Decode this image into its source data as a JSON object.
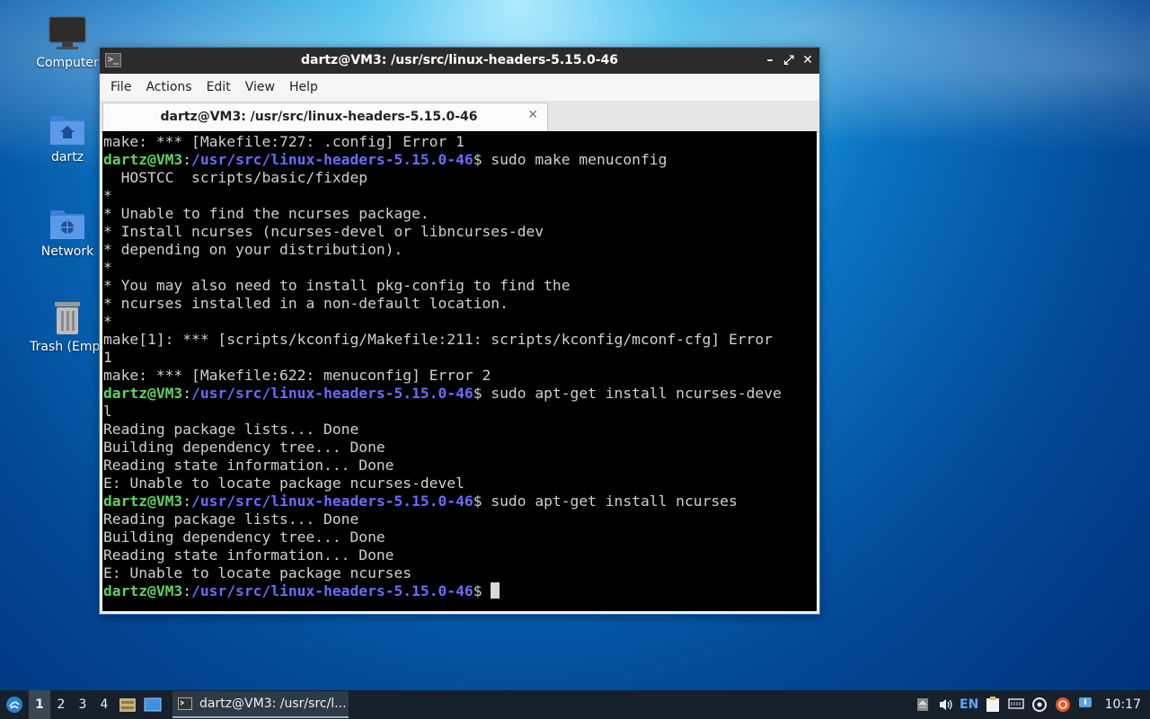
{
  "desktop": {
    "icons": [
      {
        "label": "Computer"
      },
      {
        "label": "dartz"
      },
      {
        "label": "Network"
      },
      {
        "label": "Trash (Empt"
      }
    ]
  },
  "window": {
    "title": "dartz@VM3: /usr/src/linux-headers-5.15.0-46",
    "controls": {
      "minimize": "–",
      "maximize": "⤢",
      "close": "✕"
    },
    "menu": [
      "File",
      "Actions",
      "Edit",
      "View",
      "Help"
    ],
    "tab": {
      "label": "dartz@VM3: /usr/src/linux-headers-5.15.0-46",
      "close": "✕"
    }
  },
  "terminal": {
    "prompt_user": "dartz@VM3",
    "prompt_sep": ":",
    "prompt_path": "/usr/src/linux-headers-5.15.0-46",
    "prompt_suffix": "$ ",
    "lines": [
      {
        "text": "make: *** [Makefile:727: .config] Error 1"
      },
      {
        "prompt": true,
        "cmd": "sudo make menuconfig"
      },
      {
        "text": "  HOSTCC  scripts/basic/fixdep"
      },
      {
        "text": "*"
      },
      {
        "text": "* Unable to find the ncurses package."
      },
      {
        "text": "* Install ncurses (ncurses-devel or libncurses-dev"
      },
      {
        "text": "* depending on your distribution)."
      },
      {
        "text": "*"
      },
      {
        "text": "* You may also need to install pkg-config to find the"
      },
      {
        "text": "* ncurses installed in a non-default location."
      },
      {
        "text": "*"
      },
      {
        "text": "make[1]: *** [scripts/kconfig/Makefile:211: scripts/kconfig/mconf-cfg] Error"
      },
      {
        "text": "1"
      },
      {
        "text": "make: *** [Makefile:622: menuconfig] Error 2"
      },
      {
        "prompt": true,
        "cmd": "sudo apt-get install ncurses-deve"
      },
      {
        "text": "l"
      },
      {
        "text": "Reading package lists... Done"
      },
      {
        "text": "Building dependency tree... Done"
      },
      {
        "text": "Reading state information... Done"
      },
      {
        "text": "E: Unable to locate package ncurses-devel"
      },
      {
        "prompt": true,
        "cmd": "sudo apt-get install ncurses"
      },
      {
        "text": "Reading package lists... Done"
      },
      {
        "text": "Building dependency tree... Done"
      },
      {
        "text": "Reading state information... Done"
      },
      {
        "text": "E: Unable to locate package ncurses"
      },
      {
        "prompt": true,
        "cmd": "",
        "cursor": true
      }
    ]
  },
  "taskbar": {
    "desktops": [
      "1",
      "2",
      "3",
      "4"
    ],
    "active_desktop": "1",
    "task_label": "dartz@VM3: /usr/src/l...",
    "keyboard_layout": "EN",
    "clock": "10:17"
  }
}
